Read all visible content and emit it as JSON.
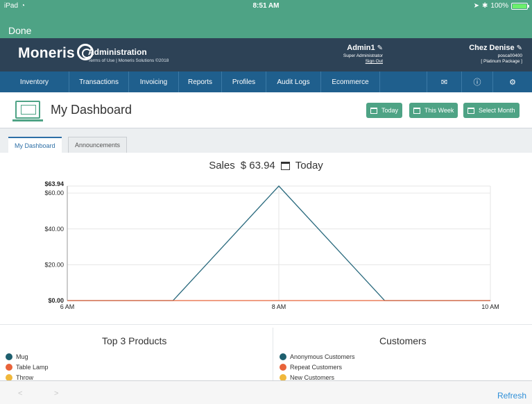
{
  "status_bar": {
    "device": "iPad",
    "time": "8:51 AM",
    "battery": "100%",
    "battery_level": 1.0
  },
  "done_label": "Done",
  "header": {
    "logo_text": "Moneris",
    "app_title": "Administration",
    "app_subtitle": "Terms of Use | Moneris Solutions ©2018",
    "user_name": "Admin1",
    "user_role": "Super Administrator",
    "sign_out": "Sign Out",
    "store_name": "Chez Denise",
    "store_id": "posca00400",
    "store_package": "[ Platinum Package ]"
  },
  "nav": {
    "items": [
      {
        "label": "Inventory"
      },
      {
        "label": "Transactions"
      },
      {
        "label": "Invoicing"
      },
      {
        "label": "Reports"
      },
      {
        "label": "Profiles"
      },
      {
        "label": "Audit Logs"
      },
      {
        "label": "Ecommerce"
      }
    ],
    "icons": [
      "mail-icon",
      "help-icon",
      "settings-icon"
    ]
  },
  "page": {
    "title": "My Dashboard",
    "buttons": {
      "today": "Today",
      "this_week": "This Week",
      "select_month": "Select Month"
    }
  },
  "tabs": {
    "dashboard": "My Dashboard",
    "announcements": "Announcements"
  },
  "sales": {
    "label": "Sales",
    "amount": "$ 63.94",
    "period": "Today"
  },
  "chart_data": {
    "type": "line",
    "x": [
      "6 AM",
      "7 AM",
      "8 AM",
      "9 AM",
      "10 AM"
    ],
    "x_tick_labels": [
      "6 AM",
      "8 AM",
      "10 AM"
    ],
    "y_tick_labels": [
      "$0.00",
      "$20.00",
      "$40.00",
      "$60.00",
      "$63.94"
    ],
    "y_ticks": [
      0,
      20,
      40,
      60,
      63.94
    ],
    "ylim": [
      0,
      63.94
    ],
    "grid": true,
    "series": [
      {
        "values": [
          0,
          0,
          63.94,
          0,
          0
        ],
        "color": "#2a6a7e"
      },
      {
        "values": [
          0,
          0,
          0,
          0,
          0
        ],
        "color": "#e8633a"
      }
    ]
  },
  "top_products": {
    "title": "Top 3 Products",
    "items": [
      {
        "label": "Mug",
        "color": "#1e5f6e"
      },
      {
        "label": "Table Lamp",
        "color": "#e8633a"
      },
      {
        "label": "Throw",
        "color": "#f0b83c"
      }
    ]
  },
  "customers": {
    "title": "Customers",
    "items": [
      {
        "label": "Anonymous Customers",
        "color": "#1e5f6e"
      },
      {
        "label": "Repeat Customers",
        "color": "#e8633a"
      },
      {
        "label": "New Customers",
        "color": "#f0b83c"
      }
    ]
  },
  "bottom": {
    "back": "<",
    "forward": ">",
    "refresh": "Refresh"
  }
}
